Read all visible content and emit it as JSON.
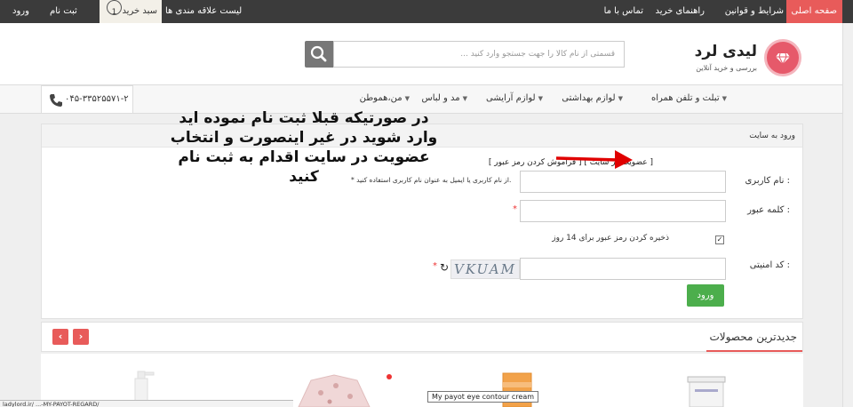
{
  "topbar": {
    "home": "صفحه اصلی",
    "terms": "شرایط و قوانین",
    "guide": "راهنمای خرید",
    "contact": "تماس با ما",
    "wishlist": "لیست علاقه مندی ها",
    "cart_label": "سبد خرید",
    "cart_count": "1",
    "register": "ثبت نام",
    "login": "ورود"
  },
  "header": {
    "logo_title": "لیدی لرد",
    "logo_subtitle": "بررسی و خرید آنلاین",
    "search_placeholder": "قسمتی از نام کالا را جهت جستجو وارد کنید ..."
  },
  "nav": {
    "items": [
      "تبلت و تلفن همراه",
      "لوازم بهداشتی",
      "لوازم آرایشی",
      "مد و لباس",
      "من،هموطن"
    ],
    "phone": "۰۴۵-۳۳۵۲۵۵۷۱-۲"
  },
  "login": {
    "title": "ورود به سایت",
    "links": "[ فراموش کردن رمز عبور ] [ عضویت در سایت ]",
    "username_label": "نام کاربری :",
    "username_hint": "* از نام کاربری یا ایمیل به عنوان نام کاربری استفاده کنید.",
    "password_label": "کلمه عبور :",
    "remember_label": "ذخیره کردن رمز عبور برای 14 روز",
    "captcha_label": "کد امنیتی :",
    "captcha_text": "VKUAM",
    "submit": "ورود"
  },
  "annotation": "در صورتیکه قبلا ثبت نام نموده اید وارد شوید در غیر اینصورت و انتخاب عضویت در سایت اقدام به ثبت نام کنید",
  "products": {
    "title": "جدیدترین محصولات",
    "tooltip": "My payot eye contour cream"
  },
  "status_url": "ladylord.ir/ ...-MY-PAYOT-REGARD/",
  "colors": {
    "accent": "#e85b5a",
    "topbar": "#3b3b3b",
    "login_button": "#4cae4c",
    "annotation_arrow": "#e00000"
  }
}
